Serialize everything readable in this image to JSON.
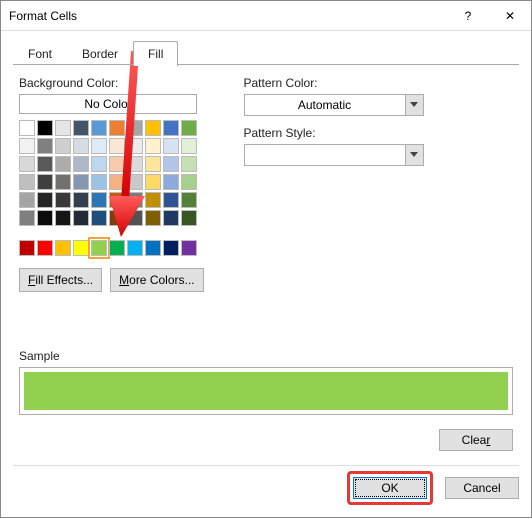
{
  "window": {
    "title": "Format Cells",
    "help_glyph": "?",
    "close_glyph": "✕"
  },
  "tabs": {
    "font": "Font",
    "border": "Border",
    "fill": "Fill",
    "active": "fill"
  },
  "left": {
    "bg_label": "Background Color:",
    "no_color": "No Color",
    "theme_colors": [
      [
        "#ffffff",
        "#000000",
        "#e7e6e6",
        "#44546a",
        "#5b9bd5",
        "#ed7d31",
        "#a5a5a5",
        "#ffc000",
        "#4472c4",
        "#70ad47"
      ],
      [
        "#f2f2f2",
        "#808080",
        "#d0cece",
        "#d6dce4",
        "#deebf6",
        "#fbe5d5",
        "#ededed",
        "#fff2cc",
        "#d9e2f3",
        "#e2efd9"
      ],
      [
        "#d8d8d8",
        "#595959",
        "#aeabab",
        "#adb9ca",
        "#bdd7ee",
        "#f7cbac",
        "#dbdbdb",
        "#fee599",
        "#b4c6e7",
        "#c5e0b3"
      ],
      [
        "#bfbfbf",
        "#3f3f3f",
        "#757070",
        "#8496b0",
        "#9cc3e5",
        "#f4b183",
        "#c9c9c9",
        "#ffd965",
        "#8eaadb",
        "#a8d08d"
      ],
      [
        "#a5a5a5",
        "#262626",
        "#3a3838",
        "#323f4f",
        "#2e75b5",
        "#c55a11",
        "#7b7b7b",
        "#bf9000",
        "#2f5496",
        "#538135"
      ],
      [
        "#7f7f7f",
        "#0c0c0c",
        "#171616",
        "#222a35",
        "#1e4e79",
        "#833c0b",
        "#525252",
        "#7f6000",
        "#1f3864",
        "#375623"
      ]
    ],
    "standard_colors": [
      "#c00000",
      "#ff0000",
      "#ffc000",
      "#ffff00",
      "#92d050",
      "#00b050",
      "#00b0f0",
      "#0070c0",
      "#002060",
      "#7030a0"
    ],
    "selected_standard_index": 4,
    "fill_effects_pre": "F",
    "fill_effects_rest": "ill Effects...",
    "more_colors_pre": "M",
    "more_colors_rest": "ore Colors..."
  },
  "right": {
    "pattern_color_label": "Pattern Color:",
    "pattern_color_value": "Automatic",
    "pattern_style_label": "Pattern Style:"
  },
  "sample": {
    "label": "Sample",
    "color": "#92d050"
  },
  "buttons": {
    "clear_pre": "Clea",
    "clear_r": "r",
    "ok": "OK",
    "cancel": "Cancel"
  }
}
